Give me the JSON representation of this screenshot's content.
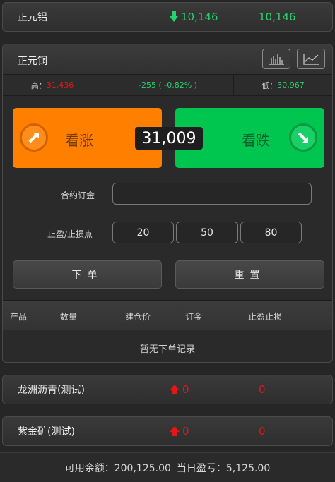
{
  "products_top": [
    {
      "name": "正元铝",
      "price": "10,146",
      "price2": "10,146",
      "direction": "down"
    }
  ],
  "main": {
    "title": "正元铜",
    "high_label": "高：",
    "high_value": "31,436",
    "change": "-255 ( -0.82% )",
    "low_label": "低：",
    "low_value": "30,967",
    "buy_up_label": "看涨",
    "buy_down_label": "看跌",
    "current_price": "31,009",
    "deposit_label": "合约订金",
    "deposit_value": "",
    "stop_label": "止盈/止损点",
    "stop_options": [
      "20",
      "50",
      "80"
    ],
    "order_button": "下单",
    "reset_button": "重置",
    "table_headers": [
      "产品",
      "数量",
      "建仓价",
      "订金",
      "止盈止损"
    ],
    "empty_text": "暂无下单记录"
  },
  "products_bottom": [
    {
      "name": "龙洲沥青(测试)",
      "value1": "0",
      "value2": "0",
      "direction": "up"
    },
    {
      "name": "紫金矿(测试)",
      "value1": "0",
      "value2": "0",
      "direction": "up"
    }
  ],
  "footer": {
    "balance_label": "可用余额：",
    "balance_value": "200,125.00",
    "pnl_label": "当日盈亏：",
    "pnl_value": "5,125.00"
  },
  "colors": {
    "up": "#ff7f00",
    "down": "#00c650",
    "green_text": "#27d36b",
    "red_text": "#e01818"
  }
}
